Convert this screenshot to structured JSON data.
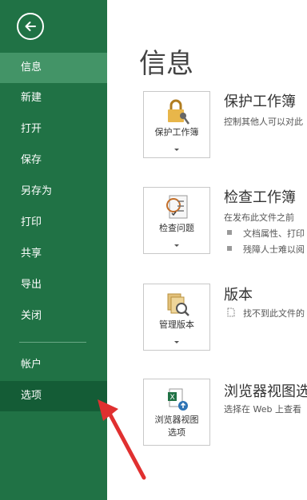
{
  "sidebar": {
    "items": [
      {
        "label": "信息",
        "state": "active"
      },
      {
        "label": "新建"
      },
      {
        "label": "打开"
      },
      {
        "label": "保存"
      },
      {
        "label": "另存为"
      },
      {
        "label": "打印"
      },
      {
        "label": "共享"
      },
      {
        "label": "导出"
      },
      {
        "label": "关闭"
      },
      {
        "label": "帐户"
      },
      {
        "label": "选项",
        "state": "selected"
      }
    ],
    "colors": {
      "background": "#207245",
      "active": "#439467",
      "selected": "#145c36"
    }
  },
  "main": {
    "title": "信息",
    "sections": [
      {
        "button_label": "保护工作簿",
        "icon": "lock-key-icon",
        "title": "保护工作簿",
        "description": "控制其他人可以对此"
      },
      {
        "button_label": "检查问题",
        "icon": "checklist-icon",
        "title": "检查工作簿",
        "description": "在发布此文件之前",
        "bullets": [
          "文档属性、打印",
          "残障人士难以阅"
        ]
      },
      {
        "button_label": "管理版本",
        "icon": "versions-icon",
        "title": "版本",
        "description": "找不到此文件的"
      },
      {
        "button_label": "浏览器视图选项",
        "button_label_line1": "浏览器视图",
        "button_label_line2": "选项",
        "icon": "excel-web-icon",
        "title": "浏览器视图选",
        "description": "选择在 Web 上查看"
      }
    ]
  },
  "annotation": {
    "arrow_color": "#e03030"
  }
}
